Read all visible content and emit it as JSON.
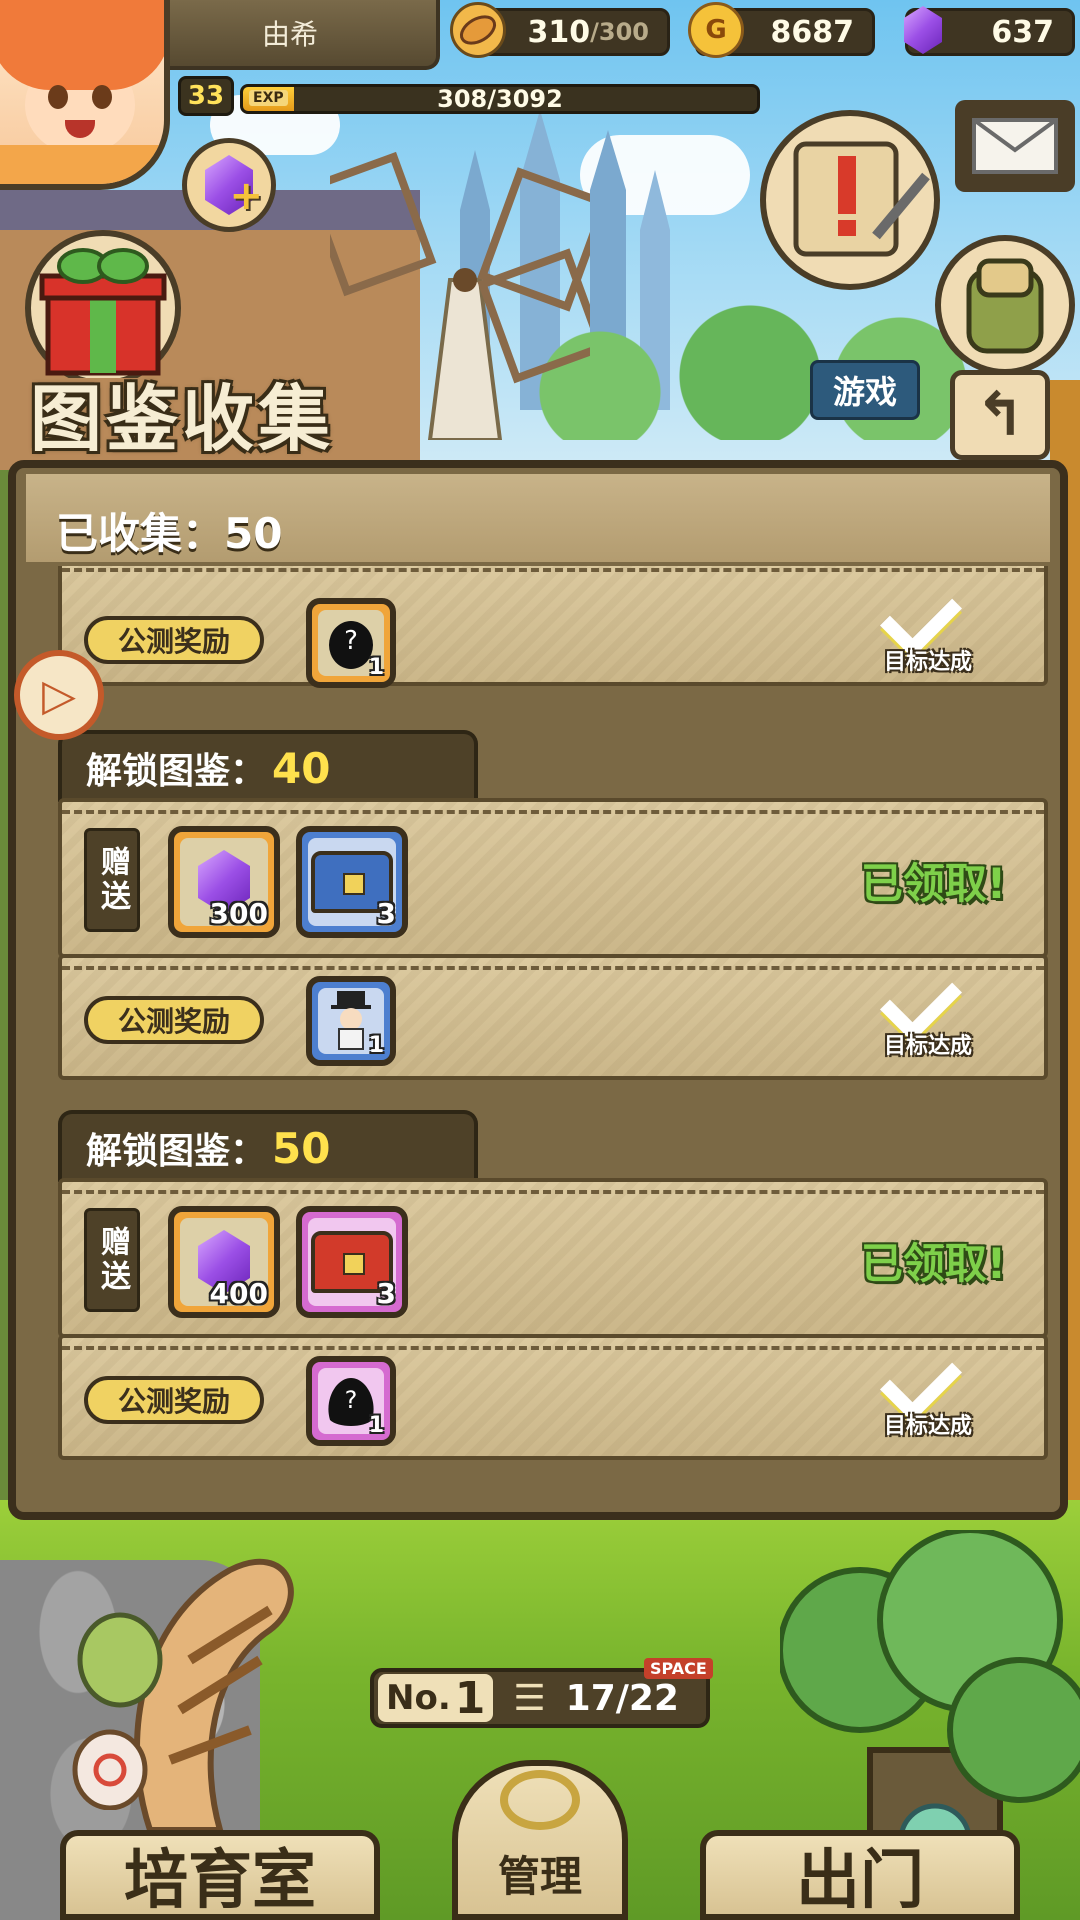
{
  "hud": {
    "player_name": "由希",
    "level": "33",
    "exp_label": "EXP",
    "exp_value": "308/3092",
    "exp_fraction": 0.0996,
    "stamina": "310",
    "stamina_max": "/300",
    "gold": "8687",
    "gold_icon_letter": "G",
    "gems": "637"
  },
  "buttons": {
    "game_tag": "游戏",
    "back_arrow": "↰",
    "side_arrow": "▷"
  },
  "panel": {
    "title": "图鉴收集",
    "collected": "已收集：50"
  },
  "rows": {
    "top_partial": {
      "beta_label": "公测奖励",
      "item_count": "1",
      "status": "目标达成"
    },
    "tier40": {
      "header_label": "解锁图鉴：",
      "header_value": "40",
      "gift_label": "赠送",
      "gem_count": "300",
      "chest_count": "3",
      "claimed": "已领取!",
      "beta_label": "公测奖励",
      "beta_item_count": "1",
      "status": "目标达成"
    },
    "tier50": {
      "header_label": "解锁图鉴：",
      "header_value": "50",
      "gift_label": "赠送",
      "gem_count": "400",
      "chest_count": "3",
      "claimed": "已领取!",
      "beta_label": "公测奖励",
      "beta_item_count": "1",
      "status": "目标达成"
    }
  },
  "bottom": {
    "no_label": "No.",
    "no_value": "1",
    "space_label": "SPACE",
    "space_value": "17/22",
    "nav_left": "培育室",
    "nav_center": "管理",
    "nav_right": "出门"
  },
  "colors": {
    "panel_bg": "#7b6945",
    "row_bg": "#dccaa0",
    "claimed_green": "#7ed04a",
    "header_value_yellow": "#ffe14d"
  }
}
